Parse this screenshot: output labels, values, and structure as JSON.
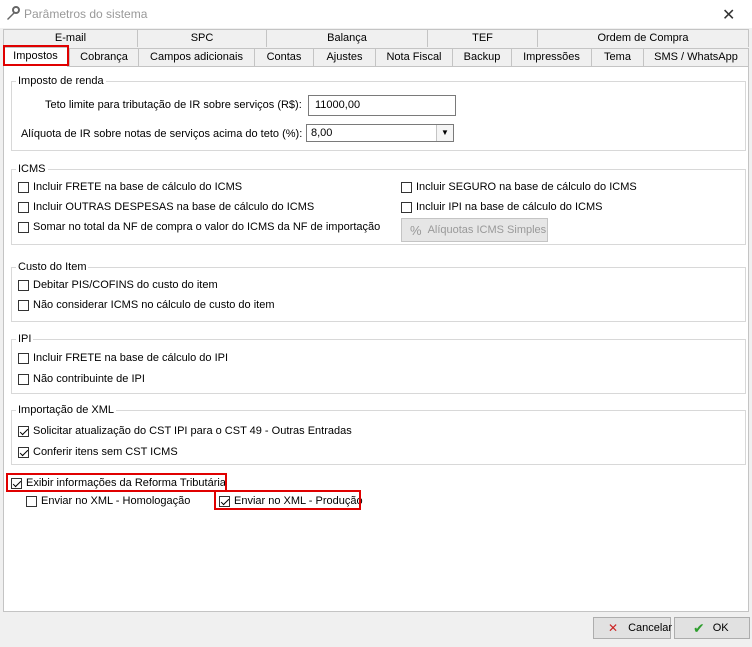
{
  "window": {
    "title": "Parâmetros do sistema"
  },
  "tabs": {
    "row1": [
      "E-mail",
      "SPC",
      "Balança",
      "TEF",
      "Ordem de Compra"
    ],
    "row2": [
      "Impostos",
      "Cobrança",
      "Campos adicionais",
      "Contas",
      "Ajustes",
      "Nota Fiscal",
      "Backup",
      "Impressões",
      "Tema",
      "SMS / WhatsApp"
    ]
  },
  "imposto_renda": {
    "title": "Imposto de renda",
    "teto_label": "Teto limite para tributação de IR sobre serviços (R$):",
    "teto_value": "11000,00",
    "aliquota_label": "Alíquota de IR sobre notas de serviços acima do teto (%):",
    "aliquota_value": "8,00"
  },
  "icms": {
    "title": "ICMS",
    "frete": "Incluir FRETE na base de cálculo do ICMS",
    "outras": "Incluir OUTRAS DESPESAS na base de cálculo do ICMS",
    "somar": "Somar no total da NF de compra o valor do ICMS da NF de importação",
    "seguro": "Incluir SEGURO na base de cálculo do ICMS",
    "ipi": "Incluir IPI na base de cálculo do ICMS",
    "aliquotas_button": "Alíquotas ICMS Simples"
  },
  "custo": {
    "title": "Custo do Item",
    "debitar": "Debitar PIS/COFINS do custo do item",
    "nao_considerar": "Não considerar ICMS no cálculo de custo do item"
  },
  "ipi": {
    "title": "IPI",
    "frete": "Incluir FRETE na base de cálculo do IPI",
    "nao_contribuinte": "Não contribuinte de IPI"
  },
  "xml": {
    "title": "Importação de XML",
    "solicitar": "Solicitar atualização do CST IPI para o CST 49 - Outras Entradas",
    "conferir": "Conferir itens sem CST ICMS"
  },
  "reforma": {
    "exibir": "Exibir informações da Reforma Tributária",
    "homologacao": "Enviar no XML - Homologação",
    "producao": "Enviar no XML - Produção"
  },
  "buttons": {
    "cancel": "Cancelar",
    "ok": "OK"
  },
  "colors": {
    "highlight": "#e00000",
    "ok_check": "#2e9e2e",
    "cancel_x": "#cc2222"
  }
}
